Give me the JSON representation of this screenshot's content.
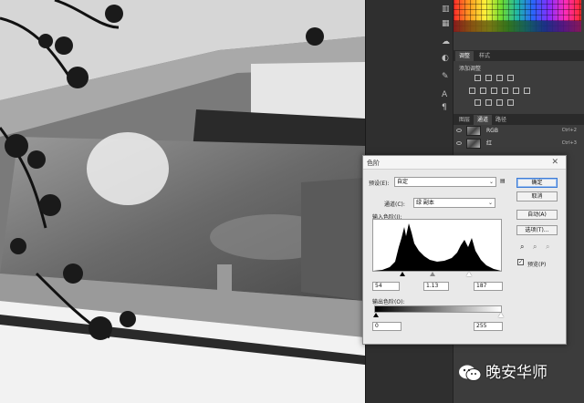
{
  "canvas": {
    "description_icon": "photo-canvas"
  },
  "panels": {
    "adjust_tabs": [
      "调整",
      "样式"
    ],
    "adjust_subtitle": "添加调整",
    "layers_tabs": [
      "图层",
      "通道",
      "路径"
    ],
    "channels": [
      {
        "name": "RGB",
        "shortcut": "Ctrl+2"
      },
      {
        "name": "红",
        "shortcut": "Ctrl+3"
      }
    ]
  },
  "dialog": {
    "title": "色阶",
    "preset_label": "预设(E):",
    "preset_value": "自定",
    "channel_label": "通道(C):",
    "channel_value": "绿 副本",
    "input_label": "输入色阶(I):",
    "input_black": "54",
    "input_gamma": "1.13",
    "input_white": "187",
    "output_label": "输出色阶(O):",
    "output_black": "0",
    "output_white": "255",
    "buttons": {
      "ok": "确定",
      "cancel": "取消",
      "auto": "自动(A)",
      "options": "选项(T)..."
    },
    "preview_label": "预览(P)",
    "preview_checked": true
  },
  "watermark": {
    "text": "晚安华师"
  }
}
